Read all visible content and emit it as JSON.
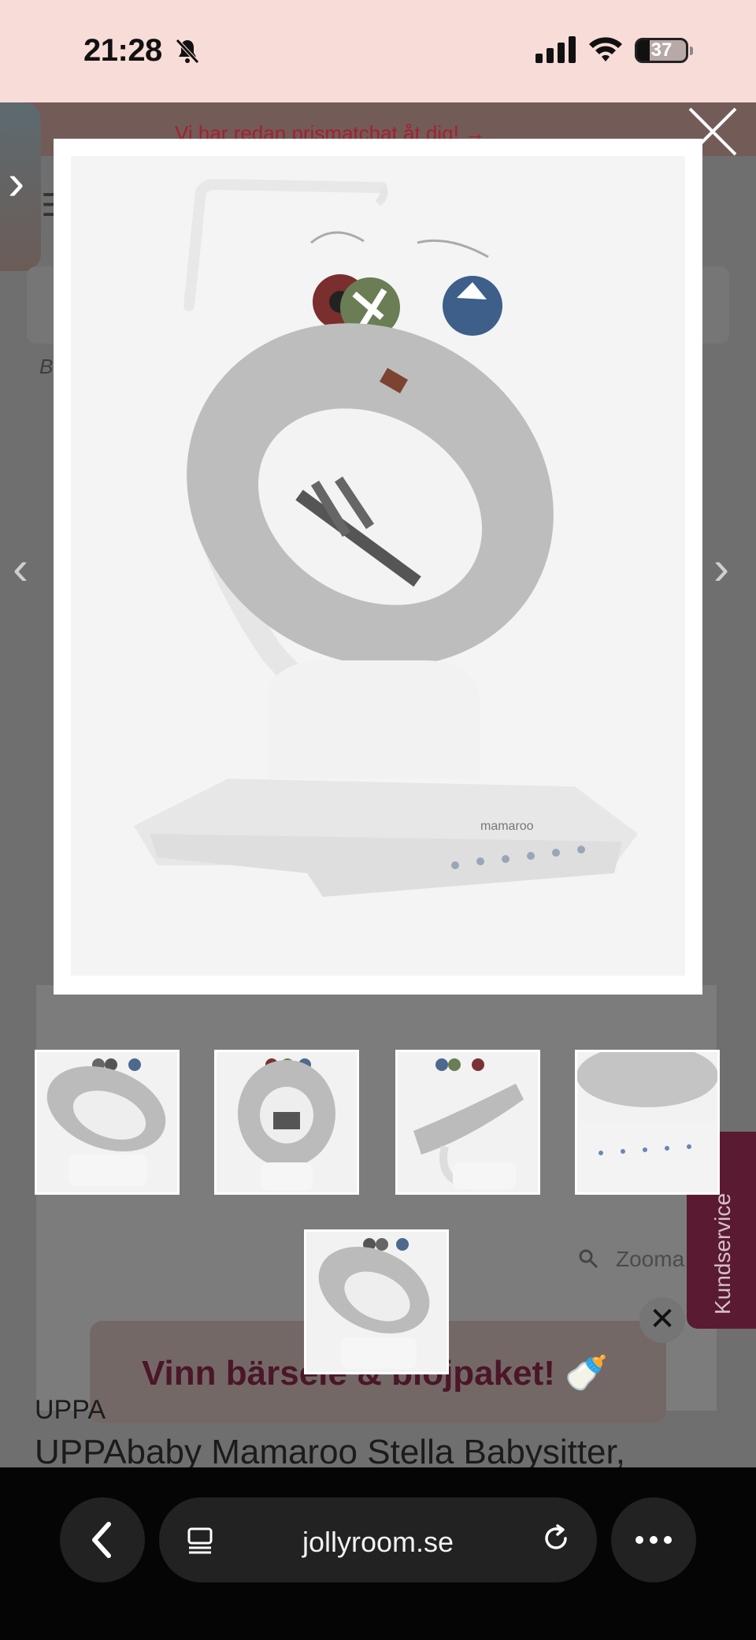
{
  "status_bar": {
    "time": "21:28",
    "battery": "37"
  },
  "page": {
    "promo_text": "Vi har redan prismatchat åt dig! →",
    "breadcrumb_stub": "B",
    "zoom_label": "Zooma",
    "kundservice_label": "Kundservice",
    "vinn_banner": "Vinn bärsele & blöjpaket! 🍼",
    "brand_small": "UPPA",
    "product_title": "UPPAbaby Mamaroo Stella Babysitter,"
  },
  "lightbox": {
    "close_label": "×",
    "thumbnails": [
      "thumb-1",
      "thumb-2",
      "thumb-3",
      "thumb-4",
      "thumb-5"
    ],
    "product_brand_on_base": "mamaroo"
  },
  "browser": {
    "url": "jollyroom.se"
  },
  "icons": {
    "bell": "bell-slash-icon",
    "signal": "signal-icon",
    "wifi": "wifi-icon",
    "battery": "battery-icon",
    "back": "chevron-left-icon",
    "tabs": "tabs-icon",
    "reload": "reload-icon",
    "more": "ellipsis-icon"
  },
  "colors": {
    "status_bg": "#f8dcd8",
    "promo_text": "#a42030",
    "kundservice_bg": "#5a1a32",
    "banner_text": "#4a1628"
  }
}
